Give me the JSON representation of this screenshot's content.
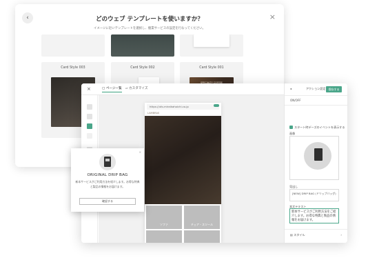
{
  "picker": {
    "title": "どのウェブ テンプレートを使いますか？",
    "subtitle": "イメージに近いテンプレートを選択し、痩業サービスの設定を行なってください。",
    "close_glyph": "×",
    "back_glyph": "‹",
    "cards": [
      {
        "name": "Card Style 003"
      },
      {
        "name": "Card Style 002"
      },
      {
        "name": "Card Style 001"
      }
    ],
    "card3_overlay": "SPECIALTY COFFEE"
  },
  "editor": {
    "close_glyph": "×",
    "tabs": [
      {
        "label": "ページ一覧"
      },
      {
        "label": "カスタマイズ"
      }
    ],
    "url": "https://ufo-miraikahoichi.co.jp",
    "site_name": "LAMBRAS",
    "modal": {
      "close_glyph": "×",
      "title": "ORIGINAL DRIP BAG",
      "description": "新本サービスがご利用方法を紹介します。お得な特典と製品の情報をお届けます。",
      "button": "確認する"
    },
    "grid_labels": [
      "ソファ",
      "チェア・スツール"
    ],
    "panel": {
      "save_label": "保存する",
      "heading": "アクション設定",
      "field_label": "ON/OFF",
      "checkbox_label": "スタート時デーズのイベントを表示する",
      "image_label": "画像",
      "caption_label": "見出し",
      "caption_value": "[NEW] DRIP BAG (ドリップバッグ)",
      "body_label": "本文テキスト",
      "body_value": "新本サービスがご利用方法をご紹介します。お得な特典と製品の情報をお届けます。",
      "style_label": "スタイル"
    }
  },
  "colors": {
    "accent": "#4aa68a"
  }
}
